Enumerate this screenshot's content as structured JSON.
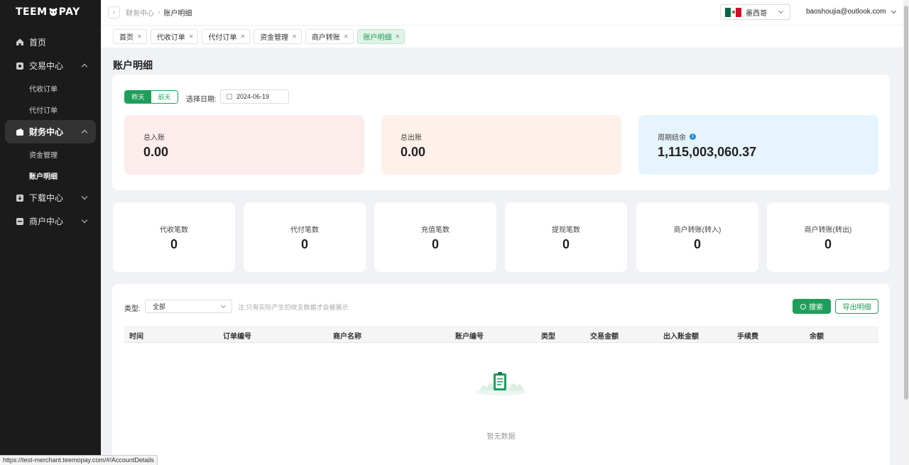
{
  "brand": {
    "logo_pre": "TEEM",
    "logo_post": "PAY"
  },
  "sidebar": {
    "home": "首页",
    "trade": "交易中心",
    "trade_items": [
      "代收订单",
      "代付订单"
    ],
    "finance": "财务中心",
    "finance_items": [
      "资金管理",
      "账户明细"
    ],
    "download": "下载中心",
    "merchant": "商户中心"
  },
  "header": {
    "breadcrumb_parent": "财务中心",
    "breadcrumb_current": "账户明细",
    "country": "墨西哥",
    "user_email": "baoshoujia@outlook.com"
  },
  "tabs": [
    "首页",
    "代收订单",
    "代付订单",
    "资金管理",
    "商户转账",
    "账户明细"
  ],
  "active_tab": "账户明细",
  "page_title": "账户明细",
  "filters": {
    "yesterday": "昨天",
    "day_before": "前天",
    "date_label": "选择日期:",
    "date_value": "2024-06-19"
  },
  "summary": {
    "total_in_label": "总入账",
    "total_in_value": "0.00",
    "total_out_label": "总出账",
    "total_out_value": "0.00",
    "period_balance_label": "周期结余",
    "period_balance_value": "1,115,003,060.37"
  },
  "counts": [
    {
      "label": "代收笔数",
      "value": "0"
    },
    {
      "label": "代付笔数",
      "value": "0"
    },
    {
      "label": "充值笔数",
      "value": "0"
    },
    {
      "label": "提现笔数",
      "value": "0"
    },
    {
      "label": "商户转账(转入)",
      "value": "0"
    },
    {
      "label": "商户转账(转出)",
      "value": "0"
    }
  ],
  "table": {
    "type_label": "类型:",
    "type_value": "全部",
    "note": "注:只有实际产生的收支数据才会被展示",
    "search_button": "搜索",
    "export_button": "导出明细",
    "columns": [
      "时间",
      "订单编号",
      "商户名称",
      "账户编号",
      "类型",
      "交易金额",
      "出入账金额",
      "手续费",
      "余额"
    ],
    "empty_text": "暂无数据"
  },
  "status_url": "https://test-merchant.teemopay.com/#/AccountDetails",
  "colors": {
    "accent": "#1e9e5a",
    "sidebar_bg": "#1b1b1b",
    "in_bg": "#fdecec",
    "out_bg": "#fdf1e9",
    "balance_bg": "#e6f4fd",
    "info": "#1f8fe0"
  }
}
